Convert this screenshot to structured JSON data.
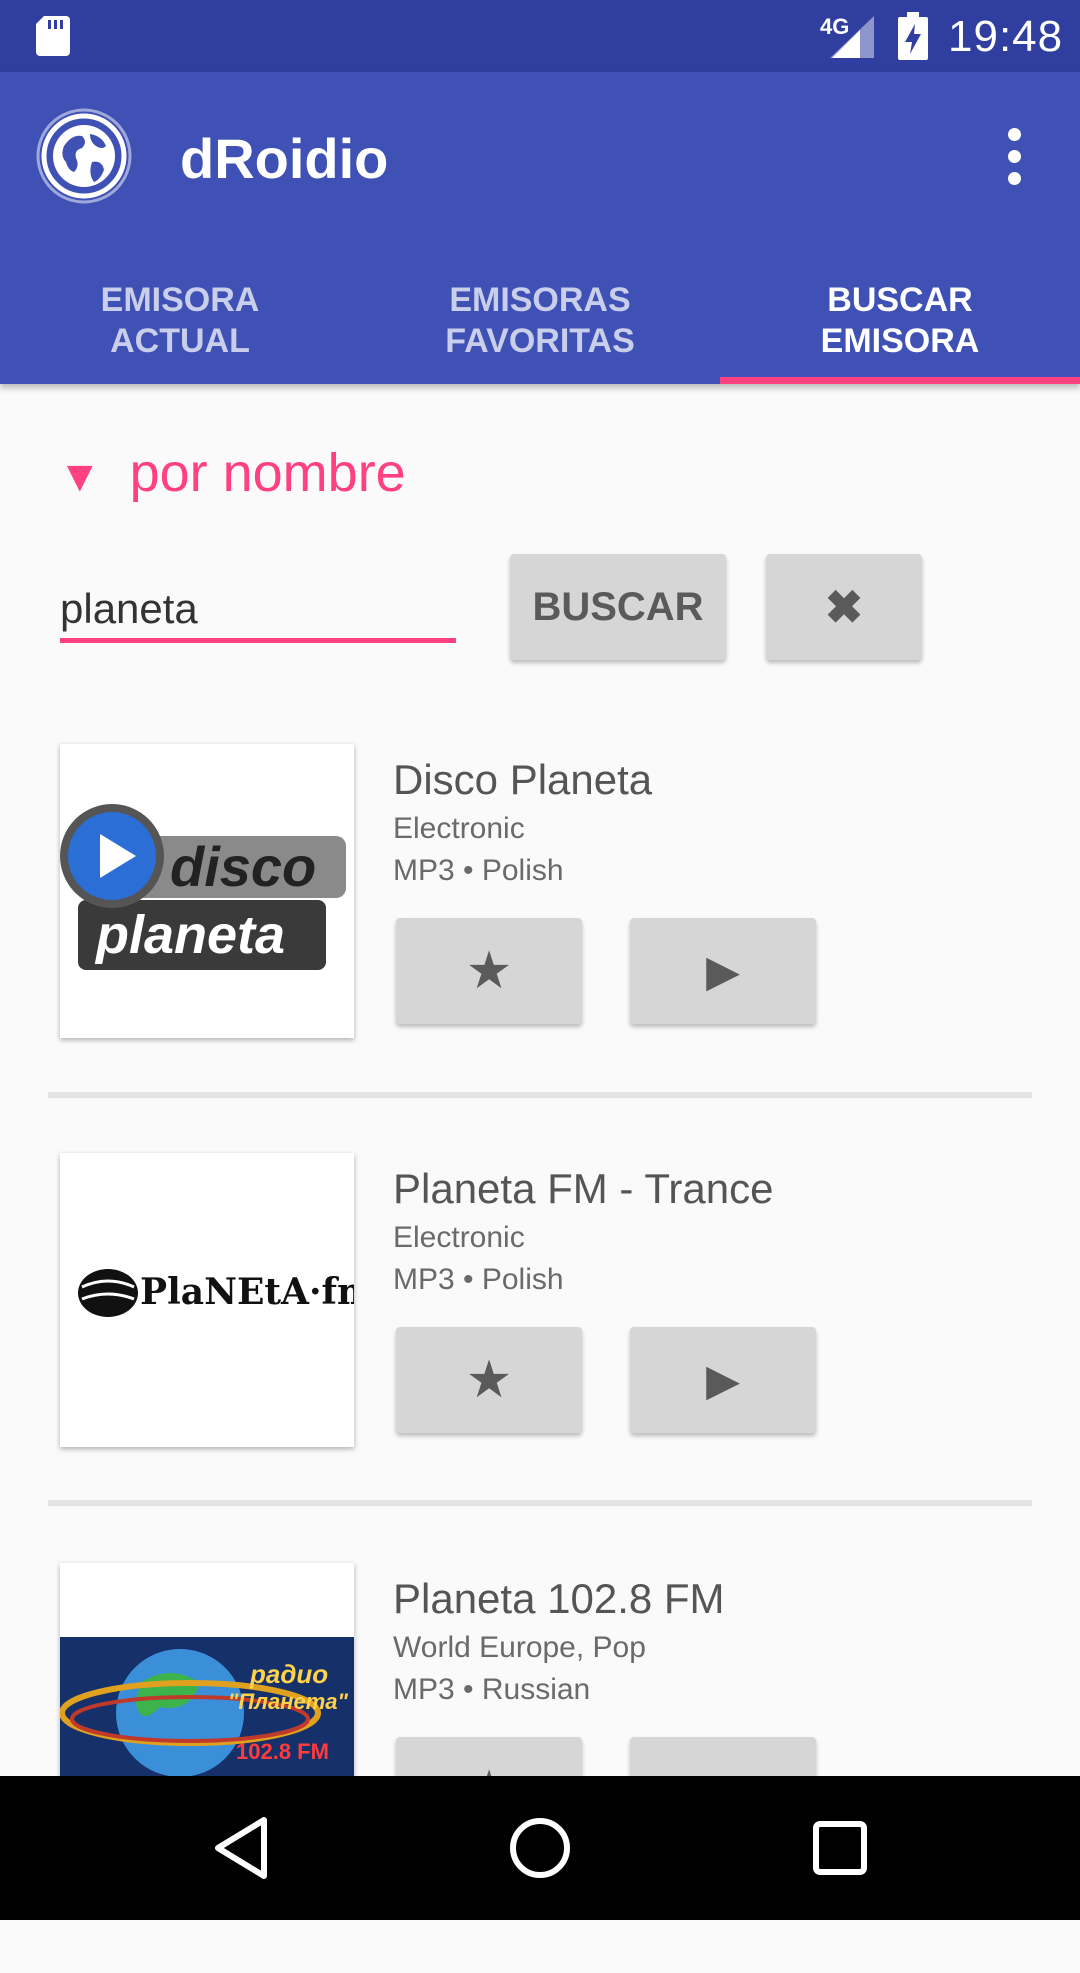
{
  "status_bar": {
    "network": "4G",
    "time": "19:48"
  },
  "app_bar": {
    "title": "dRoidio",
    "logo_icon": "globe-icon",
    "menu_icon": "more-vert-icon"
  },
  "tabs": [
    {
      "label": "EMISORA ACTUAL",
      "active": false
    },
    {
      "label": "EMISORAS FAVORITAS",
      "active": false
    },
    {
      "label": "BUSCAR EMISORA",
      "active": true
    }
  ],
  "search": {
    "section_label": "por nombre",
    "section_icon": "triangle-down-icon",
    "query": "planeta",
    "search_button": "BUSCAR",
    "clear_button": "✖"
  },
  "results": [
    {
      "name": "Disco Planeta",
      "genre": "Electronic",
      "meta": "MP3 • Polish",
      "logo_text_1": "disco",
      "logo_text_2": "planeta",
      "fav_glyph": "★",
      "play_glyph": "▶"
    },
    {
      "name": "Planeta FM - Trance",
      "genre": "Electronic",
      "meta": "MP3 • Polish",
      "logo_text_1": "PlaNEtA·fm",
      "fav_glyph": "★",
      "play_glyph": "▶"
    },
    {
      "name": "Planeta 102.8 FM",
      "genre": "World Europe, Pop",
      "meta": "MP3 • Russian",
      "logo_text_1": "радио",
      "logo_text_2": "\"Планета\"",
      "logo_text_3": "102.8 FM",
      "fav_glyph": "★",
      "play_glyph": "▶"
    }
  ],
  "colors": {
    "primary": "#3f51b5",
    "primary_dark": "#303f9f",
    "accent": "#ff4081"
  }
}
